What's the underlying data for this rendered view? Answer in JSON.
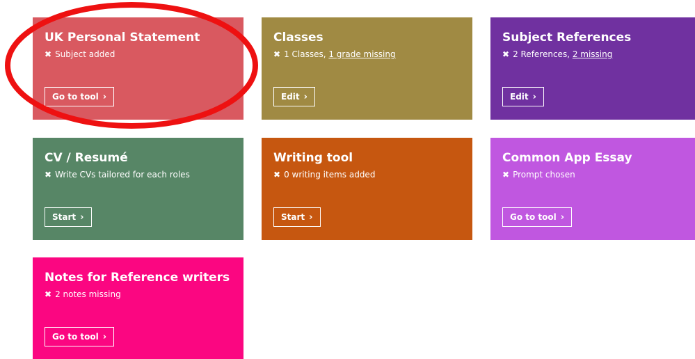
{
  "cards": [
    {
      "title": "UK Personal Statement",
      "status_prefix": "Subject added",
      "status_link": "",
      "button_label": "Go to tool",
      "color": "#d95960"
    },
    {
      "title": "Classes",
      "status_prefix": "1 Classes, ",
      "status_link": "1 grade missing",
      "button_label": "Edit",
      "color": "#a08a43"
    },
    {
      "title": "Subject References",
      "status_prefix": "2 References, ",
      "status_link": "2 missing",
      "button_label": "Edit",
      "color": "#7031a0"
    },
    {
      "title": "CV / Resumé",
      "status_prefix": "Write CVs tailored for each roles",
      "status_link": "",
      "button_label": "Start",
      "color": "#578666"
    },
    {
      "title": "Writing tool",
      "status_prefix": "0 writing items added",
      "status_link": "",
      "button_label": "Start",
      "color": "#c65710"
    },
    {
      "title": "Common App Essay",
      "status_prefix": "Prompt chosen",
      "status_link": "",
      "button_label": "Go to tool",
      "color": "#c057e0"
    },
    {
      "title": "Notes for Reference writers",
      "status_prefix": "2 notes missing",
      "status_link": "",
      "button_label": "Go to tool",
      "color": "#fb0681"
    }
  ],
  "icons": {
    "status": "close-icon",
    "button": "chevron-right-icon"
  },
  "annotation_color": "#ee1111"
}
